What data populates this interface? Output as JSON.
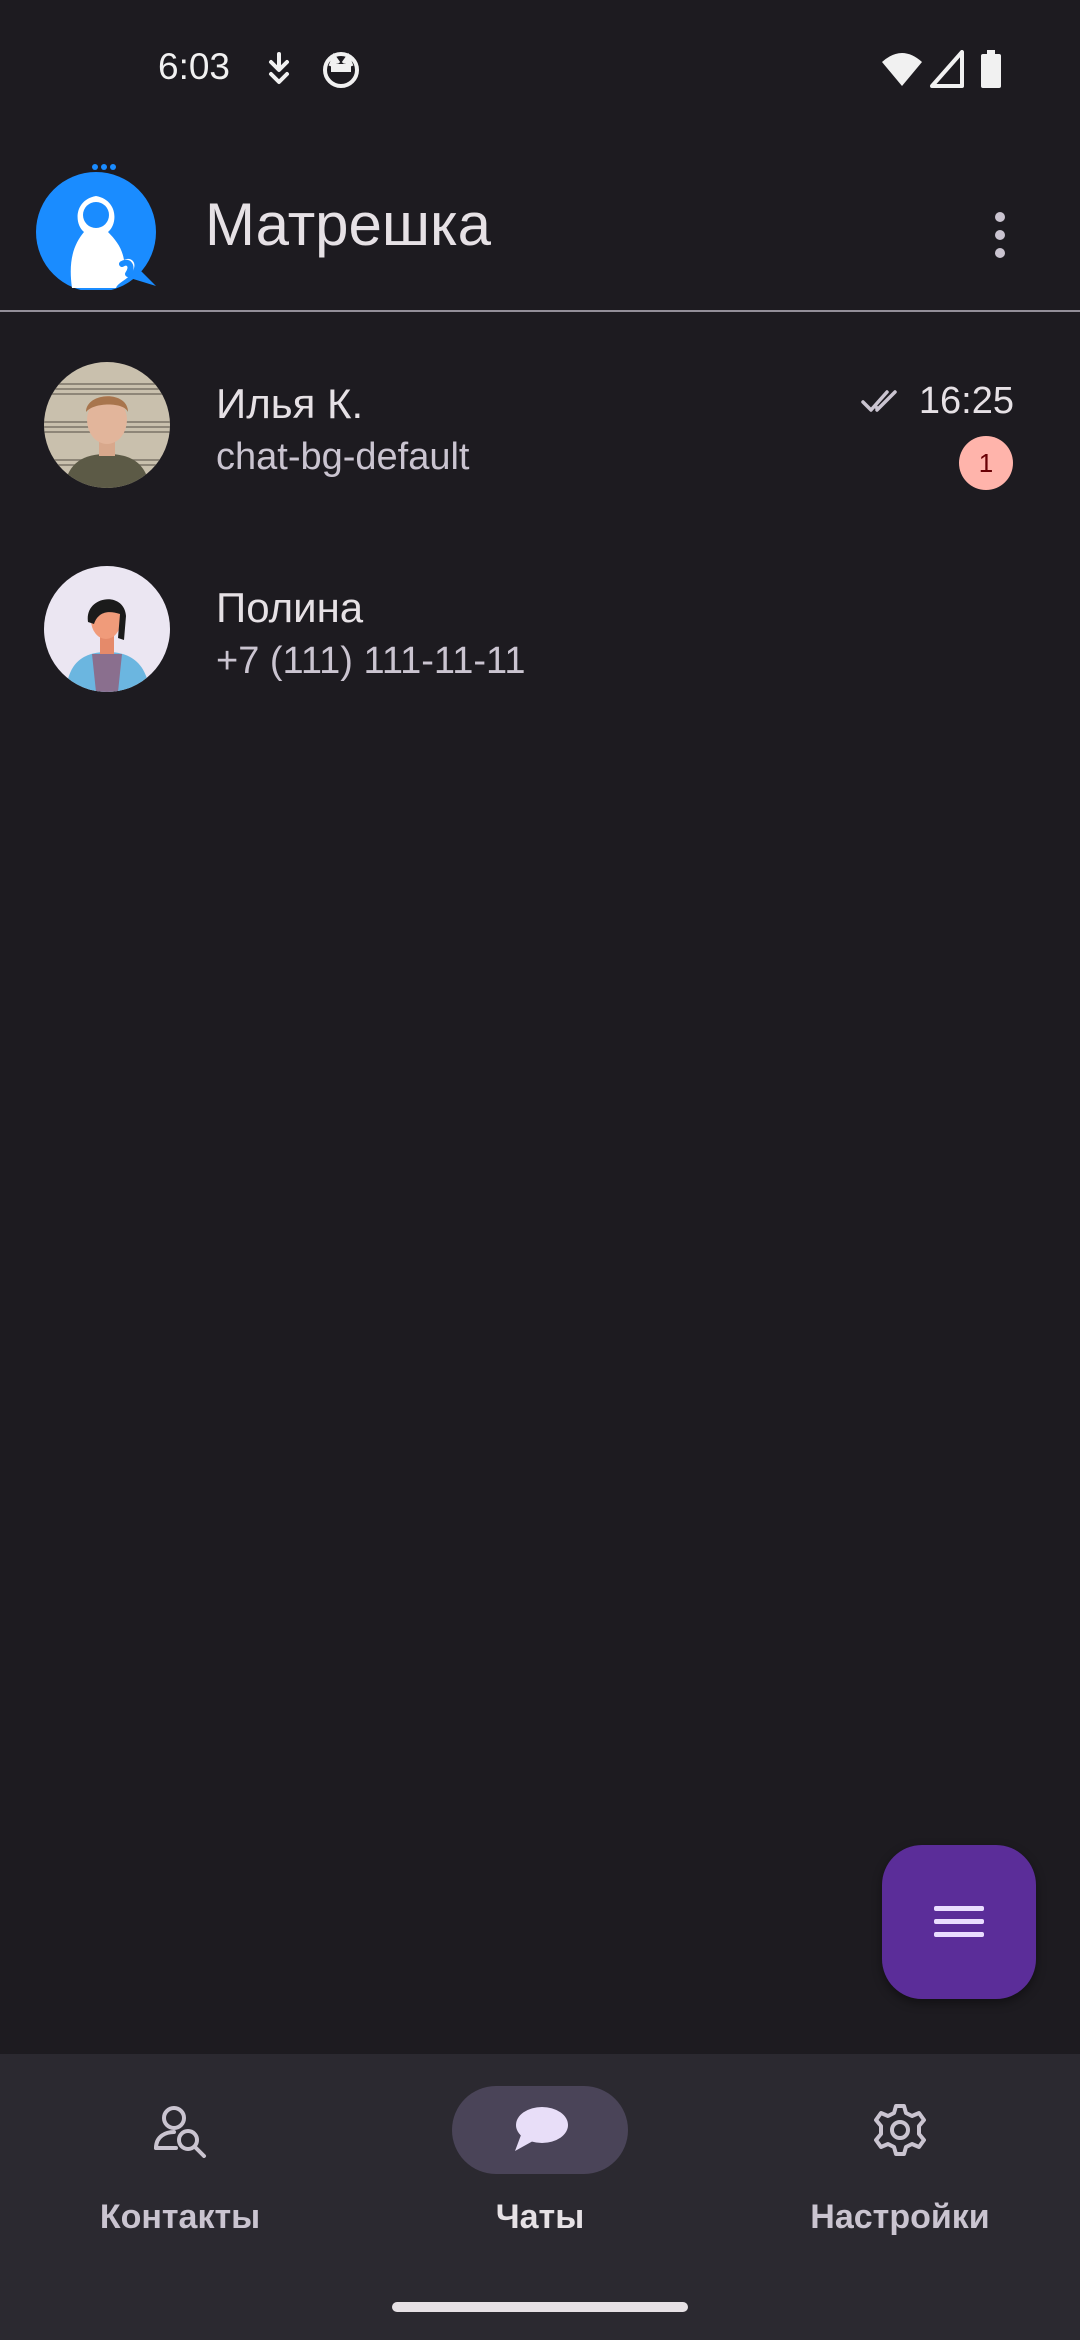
{
  "status_bar": {
    "time": "6:03",
    "icons": [
      "download-icon",
      "cat-icon",
      "wifi-icon",
      "signal-icon",
      "battery-icon"
    ]
  },
  "app_bar": {
    "title": "Матрешка",
    "logo_icon": "matryoshka-logo-icon",
    "menu_icon": "more-vert-icon"
  },
  "chats": [
    {
      "name": "Илья К.",
      "subtitle": "chat-bg-default",
      "time": "16:25",
      "status_icon": "double-check-icon",
      "unread": "1"
    },
    {
      "name": "Полина",
      "subtitle": "+7 (111) 111-11-11"
    }
  ],
  "fab": {
    "icon": "menu-icon"
  },
  "bottom_nav": {
    "items": [
      {
        "label": "Контакты",
        "icon": "contacts-search-icon"
      },
      {
        "label": "Чаты",
        "icon": "chat-bubble-icon",
        "active": true
      },
      {
        "label": "Настройки",
        "icon": "settings-gear-icon"
      }
    ]
  },
  "colors": {
    "background": "#1d1b20",
    "accent_logo": "#1a8cff",
    "fab": "#5b2d99",
    "badge": "#ffb4ab",
    "nav_active_pill": "#4a4458"
  }
}
